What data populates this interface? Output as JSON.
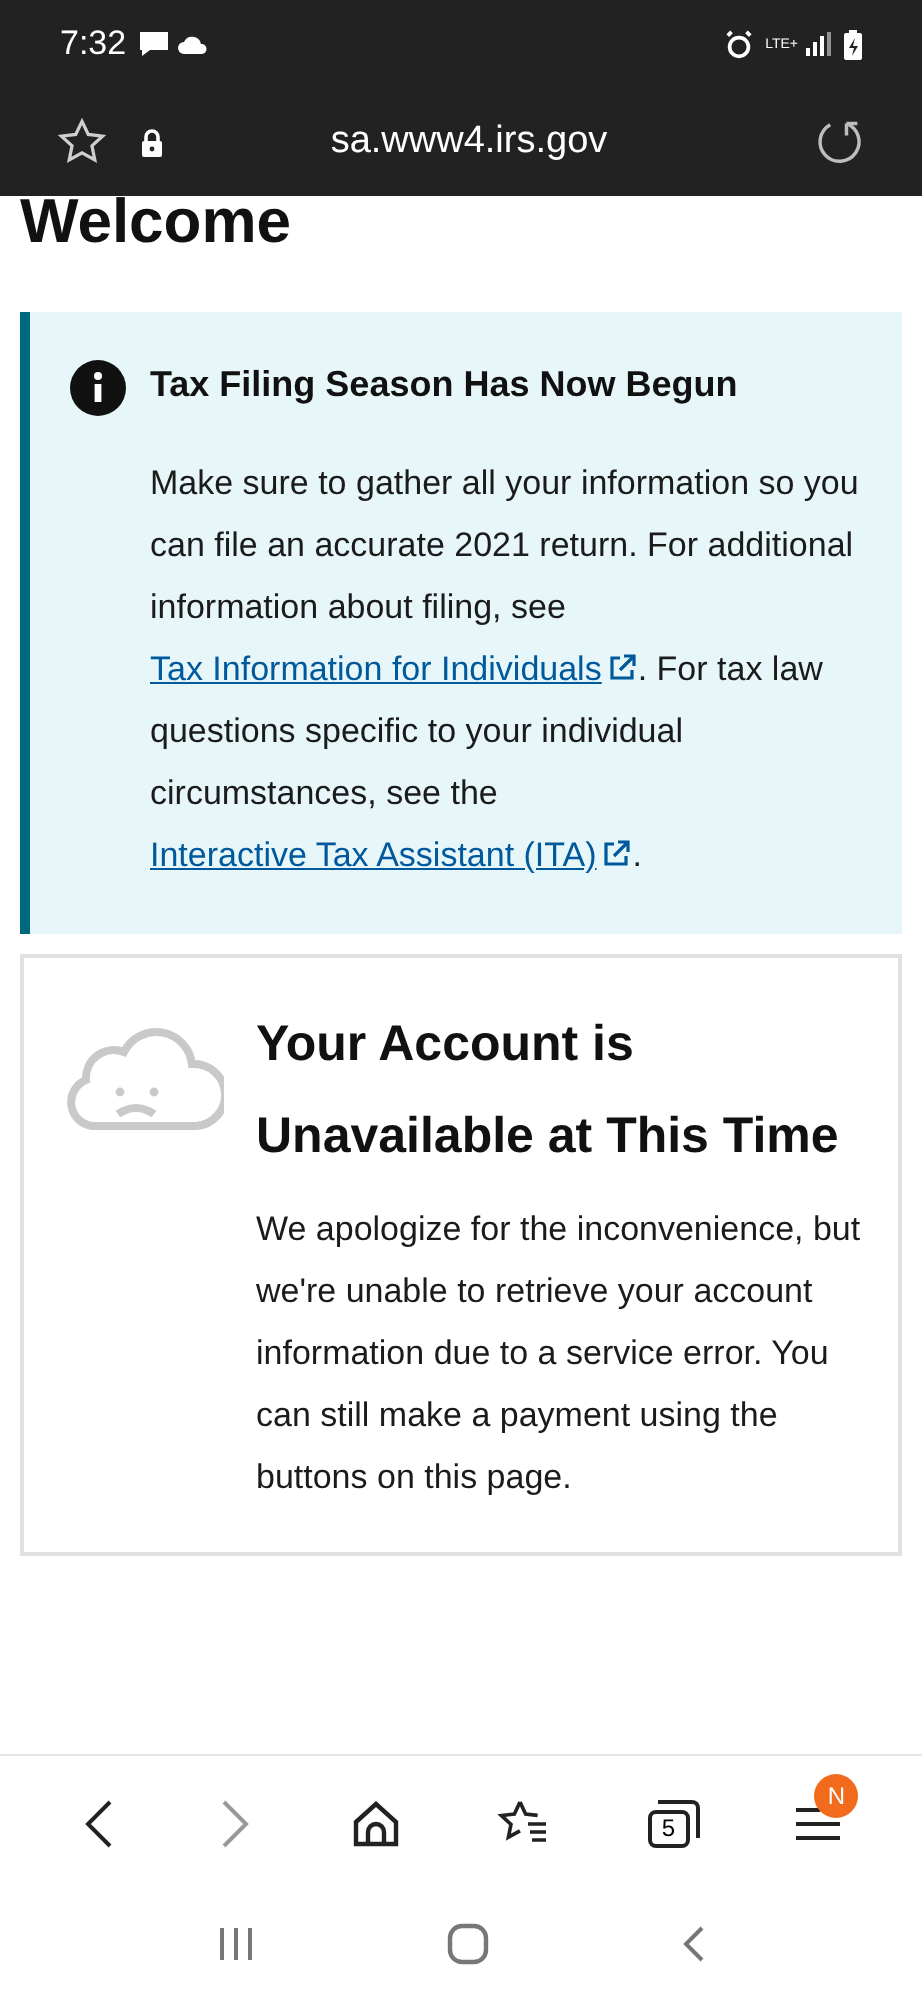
{
  "status_bar": {
    "time": "7:32",
    "network": "LTE+"
  },
  "url_bar": {
    "url": "sa.www4.irs.gov"
  },
  "page": {
    "heading": "Welcome",
    "alert": {
      "title": "Tax Filing Season Has Now Begun",
      "body": [
        {
          "kind": "text",
          "text": "Make sure to gather all your information so you can file an accurate 2021 return. For additional information about filing, see "
        },
        {
          "kind": "link",
          "text": "Tax Information for Individuals"
        },
        {
          "kind": "text",
          "text": ". For tax law questions specific to your individual circumstances, see the "
        },
        {
          "kind": "link",
          "text": "Interactive Tax Assistant (ITA)"
        },
        {
          "kind": "text",
          "text": "."
        }
      ]
    },
    "notice": {
      "title": "Your Account is Unavailable at This Time",
      "body": "We apologize for the inconvenience, but we're unable to retrieve your account information due to a service error. You can still make a payment using the buttons on this page."
    }
  },
  "browser_toolbar": {
    "tab_count": "5",
    "menu_badge": "N",
    "forward_disabled": true
  }
}
